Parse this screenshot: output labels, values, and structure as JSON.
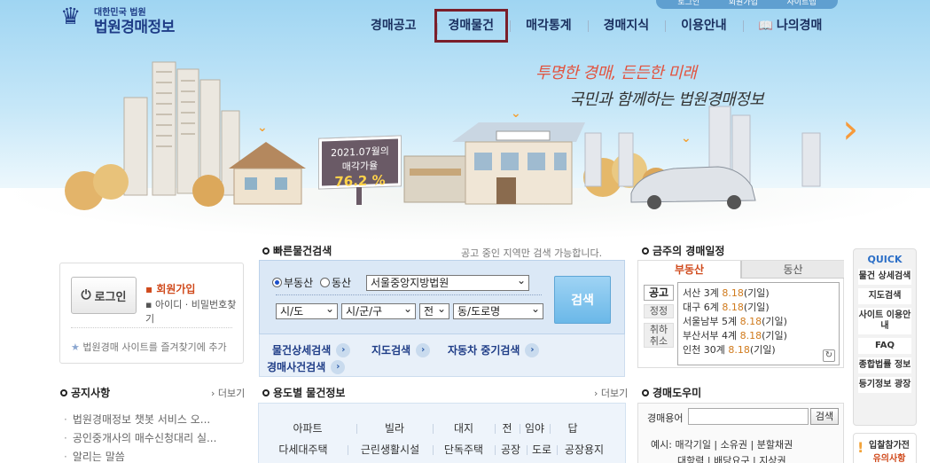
{
  "logo": {
    "sub": "대한민국 법원",
    "main": "법원경매정보"
  },
  "topbar": [
    "로그인",
    "회원가입",
    "사이트맵"
  ],
  "gnb": [
    {
      "label": "경매공고"
    },
    {
      "label": "경매물건"
    },
    {
      "label": "매각통계"
    },
    {
      "label": "경매지식"
    },
    {
      "label": "이용안내"
    },
    {
      "label": "나의경매"
    }
  ],
  "hero": {
    "slogan1": "투명한 경매, 든든한 미래",
    "slogan2": "국민과 함께하는 법원경매정보",
    "rate_line1": "2021.07월의",
    "rate_line2": "매각가율",
    "rate_value": "76.2 %",
    "colors": {
      "accent_orange": "#f79a3a",
      "slogan_red": "#e2533f"
    }
  },
  "login": {
    "button": "로그인",
    "join": "회원가입",
    "find": "아이디 · 비밀번호찾기",
    "favorite": "법원경매 사이트를 즐겨찾기에 추가"
  },
  "quick_search": {
    "title": "빠른물건검색",
    "note": "공고 중인 지역만 검색 가능합니다.",
    "radio_real_estate": "부동산",
    "radio_movable": "동산",
    "court": "서울중앙지방법원",
    "sido": "시/도",
    "sigungu": "시/군/구",
    "jeon": "전",
    "dong": "동/도로명",
    "search_button": "검색",
    "links": [
      "물건상세검색",
      "지도검색",
      "자동차 중기검색",
      "경매사건검색"
    ]
  },
  "schedule": {
    "title": "금주의 경매일정",
    "tab_active": "부동산",
    "tab_inactive": "동산",
    "side": [
      "공고",
      "정정",
      "취하 취소"
    ],
    "rows": [
      {
        "place": "서산 3계",
        "date": "8.18",
        "kind": "(기일)"
      },
      {
        "place": "대구 6계",
        "date": "8.18",
        "kind": "(기일)"
      },
      {
        "place": "서울남부 5계",
        "date": "8.18",
        "kind": "(기일)"
      },
      {
        "place": "부산서부 4계",
        "date": "8.18",
        "kind": "(기일)"
      },
      {
        "place": "인천 30계",
        "date": "8.18",
        "kind": "(기일)"
      }
    ]
  },
  "quick": {
    "title": "QUICK",
    "items": [
      "물건 상세검색",
      "지도검색",
      "사이트 이용안내",
      "FAQ",
      "종합법률 정보",
      "등기정보 광장"
    ],
    "warn_a": "입찰참가전",
    "warn_b": "유의사항"
  },
  "notice": {
    "title": "공지사항",
    "more": "더보기",
    "items": [
      "법원경매정보 챗봇 서비스 오...",
      "공인중개사의 매수신청대리 실...",
      "알리는 말씀"
    ]
  },
  "use_info": {
    "title": "용도별 물건정보",
    "more": "더보기",
    "row1": [
      "아파트",
      "빌라",
      "대지",
      "전",
      "임야",
      "답"
    ],
    "row2": [
      "다세대주택",
      "근린생활시설",
      "단독주택",
      "공장",
      "도로",
      "공장용지"
    ]
  },
  "helper": {
    "title": "경매도우미",
    "label": "경매용어",
    "button": "검색",
    "example_prefix": "예시:",
    "examples1": [
      "매각기일",
      "소유권",
      "분할채권"
    ],
    "examples2": [
      "대항력",
      "배당요구",
      "지상권"
    ]
  }
}
